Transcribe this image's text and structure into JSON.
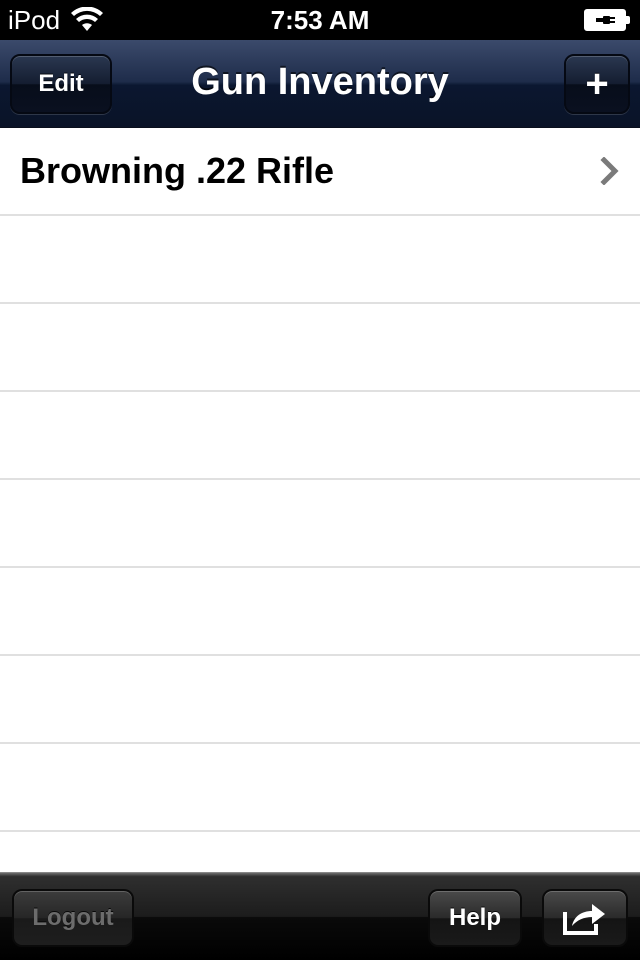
{
  "status_bar": {
    "carrier": "iPod",
    "time": "7:53 AM"
  },
  "nav": {
    "title": "Gun Inventory",
    "edit_label": "Edit",
    "add_label": "+"
  },
  "list": {
    "items": [
      {
        "label": "Browning .22 Rifle"
      }
    ]
  },
  "toolbar": {
    "logout_label": "Logout",
    "help_label": "Help",
    "share_icon": "share-icon"
  },
  "colors": {
    "nav_bar": "#1e2c4a",
    "toolbar": "#1c1c1c",
    "separator": "#e0e0e0"
  }
}
